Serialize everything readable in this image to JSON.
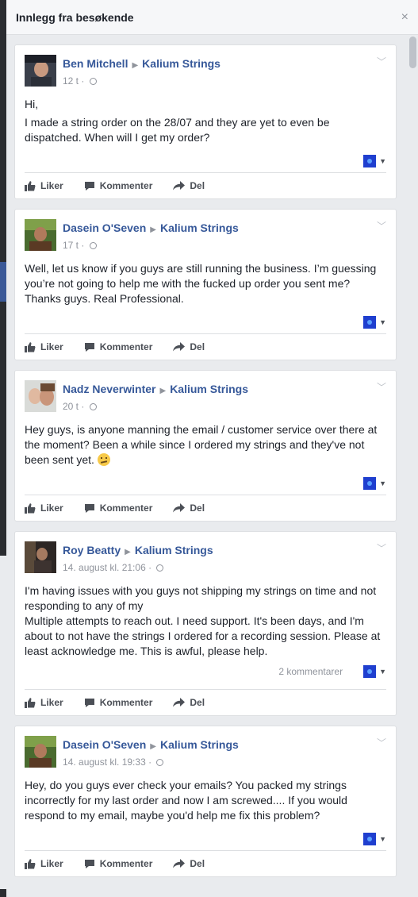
{
  "dialog": {
    "title": "Innlegg fra besøkende",
    "close": "×"
  },
  "actions": {
    "like": "Liker",
    "comment": "Kommenter",
    "share": "Del"
  },
  "posts": [
    {
      "author": "Ben Mitchell",
      "page": "Kalium Strings",
      "time": "12 t",
      "paragraphs": [
        "Hi,",
        "I made a string order on the 28/07 and they are yet to even be dispatched. When will I get my order?"
      ],
      "comments": ""
    },
    {
      "author": "Dasein O'Seven",
      "page": "Kalium Strings",
      "time": "17 t",
      "paragraphs": [
        "Well, let us know if you guys are still running the business. I’m guessing you’re not going to help me with the fucked up order you sent me? Thanks guys. Real Professional."
      ],
      "comments": ""
    },
    {
      "author": "Nadz Neverwinter",
      "page": "Kalium Strings",
      "time": "20 t",
      "paragraphs": [
        "Hey guys, is anyone manning the email / customer service over there at the moment? Been a while since I ordered my strings and they've not been sent yet."
      ],
      "comments": ""
    },
    {
      "author": "Roy Beatty",
      "page": "Kalium Strings",
      "time": "14. august kl. 21:06",
      "paragraphs": [
        "I'm having issues with you guys not shipping my strings on time and not responding to any of my",
        "Multiple attempts to reach out. I need support. It's been days, and I'm about to not have the strings I ordered for a recording session. Please at least acknowledge me. This is awful, please help."
      ],
      "comments": "2 kommentarer"
    },
    {
      "author": "Dasein O'Seven",
      "page": "Kalium Strings",
      "time": "14. august kl. 19:33",
      "paragraphs": [
        "Hey, do you guys ever check your emails? You packed my strings incorrectly for my last order and now I am screwed.... If you would respond to my email, maybe you'd help me fix this problem?"
      ],
      "comments": ""
    }
  ]
}
